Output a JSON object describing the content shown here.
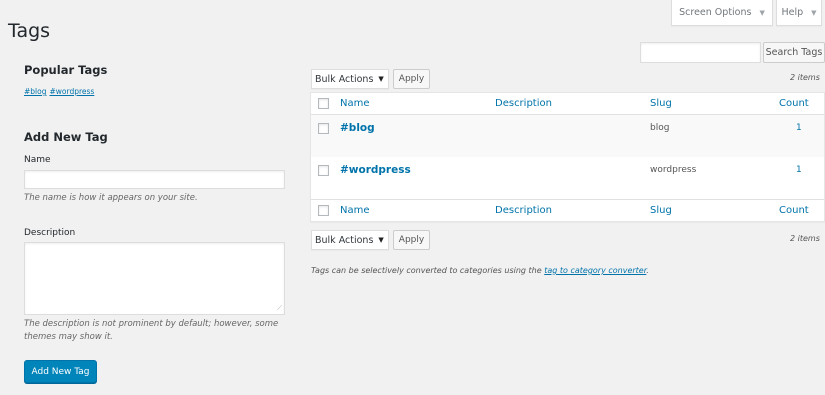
{
  "page_title": "Tags",
  "screen_options": {
    "label": "Screen Options",
    "caret": "▼"
  },
  "help": {
    "label": "Help",
    "caret": "▼"
  },
  "search": {
    "value": "",
    "button_label": "Search Tags"
  },
  "popular_tags": {
    "heading": "Popular Tags",
    "tags": [
      "#blog",
      "#wordpress"
    ]
  },
  "add_new": {
    "heading": "Add New Tag",
    "name_label": "Name",
    "name_value": "",
    "name_help": "The name is how it appears on your site.",
    "description_label": "Description",
    "description_value": "",
    "description_help": "The description is not prominent by default; however, some themes may show it.",
    "submit_label": "Add New Tag"
  },
  "bulk_actions": {
    "selected": "Bulk Actions",
    "apply_label": "Apply"
  },
  "items_count": "2 items",
  "table": {
    "columns": {
      "name": "Name",
      "description": "Description",
      "slug": "Slug",
      "count": "Count"
    },
    "rows": [
      {
        "name": "#blog",
        "description": "",
        "slug": "blog",
        "count": "1"
      },
      {
        "name": "#wordpress",
        "description": "",
        "slug": "wordpress",
        "count": "1"
      }
    ]
  },
  "converter_note": {
    "text": "Tags can be selectively converted to categories using the ",
    "link": "tag to category converter",
    "end": "."
  },
  "colors": {
    "accent": "#0085ba",
    "link": "#0073aa",
    "background": "#f1f1f1"
  }
}
